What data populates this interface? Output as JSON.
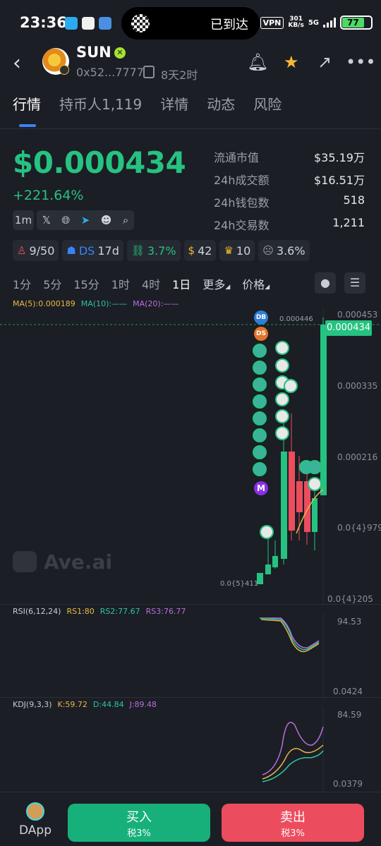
{
  "status_bar": {
    "time": "23:36",
    "island_text": "已到达",
    "vpn": "VPN",
    "speed_value": "301",
    "speed_unit": "KB/s",
    "network": "5G",
    "battery": "77"
  },
  "header": {
    "token_name": "SUN",
    "address": "0x52...7777",
    "age": "8天2时"
  },
  "tabs": [
    {
      "label": "行情"
    },
    {
      "label": "持币人1,119"
    },
    {
      "label": "详情"
    },
    {
      "label": "动态"
    },
    {
      "label": "风险"
    }
  ],
  "price": {
    "value": "$0.000434",
    "change": "+221.64%",
    "interval": "1m"
  },
  "stats": [
    {
      "label": "流通市值",
      "value": "$35.19万"
    },
    {
      "label": "24h成交额",
      "value": "$16.51万"
    },
    {
      "label": "24h钱包数",
      "value": "518"
    },
    {
      "label": "24h交易数",
      "value": "1,211"
    }
  ],
  "metrics": [
    {
      "icon": "user-star-icon",
      "value": "9/50"
    },
    {
      "icon": "ds-icon",
      "prefix": "DS",
      "value": "17d"
    },
    {
      "icon": "link-icon",
      "value": "3.7%"
    },
    {
      "icon": "money-bag-icon",
      "value": "42"
    },
    {
      "icon": "trophy-icon",
      "value": "10"
    },
    {
      "icon": "face-icon",
      "value": "3.6%"
    }
  ],
  "timeframes": {
    "items": [
      "1分",
      "5分",
      "15分",
      "1时",
      "4时",
      "1日"
    ],
    "active": "1日",
    "more": "更多",
    "mode": "价格"
  },
  "chart": {
    "ma_labels": {
      "ma5": "MA(5):0.000189",
      "ma10": "MA(10):——",
      "ma20": "MA(20):——"
    },
    "y_axis": [
      "0.000453",
      "0.000335",
      "0.000216",
      "0.0{4}979",
      "0.0{4}205"
    ],
    "last_price_tag": "0.000434",
    "high_label": "0.000446",
    "low_label": "0.0{5}411",
    "watermark": "Ave.ai",
    "marker_db": "DB",
    "marker_ds": "DS",
    "marker_m": "M"
  },
  "rsi": {
    "label": "RSI(6,12,24)",
    "rs1": "RS1:80",
    "rs2": "RS2:77.67",
    "rs3": "RS3:76.77",
    "top": "94.53",
    "bottom": "0.0424"
  },
  "kdj": {
    "label": "KDJ(9,3,3)",
    "k": "K:59.72",
    "d": "D:44.84",
    "j": "J:89.48",
    "top": "84.59",
    "bottom": "0.0379"
  },
  "bottom": {
    "dapp": "DApp",
    "buy": "买入",
    "buy_tax": "税3%",
    "sell": "卖出",
    "sell_tax": "税3%"
  },
  "colors": {
    "up": "#26c281",
    "down": "#ec4d5e",
    "accent": "#3b82f6"
  }
}
